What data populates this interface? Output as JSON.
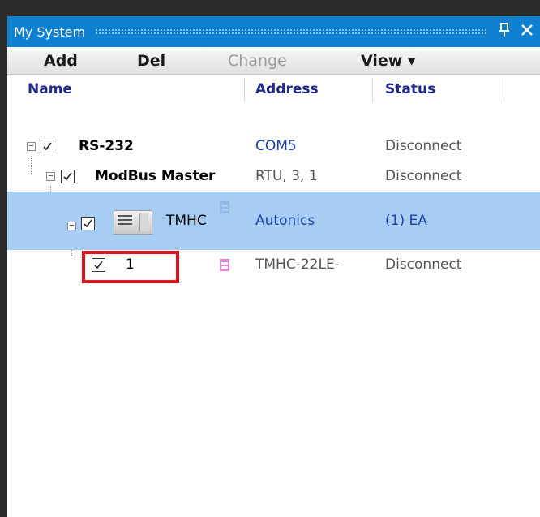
{
  "window": {
    "title": "My System",
    "pin_icon": "pin-icon",
    "close_icon": "close-icon"
  },
  "toolbar": {
    "add_label": "Add",
    "del_label": "Del",
    "change_label": "Change",
    "view_label": "View ▾"
  },
  "columns": {
    "name": "Name",
    "address": "Address",
    "status": "Status"
  },
  "rows": [
    {
      "name": "RS-232",
      "address": "COM5",
      "status": "Disconnect",
      "checked": true
    },
    {
      "name": "ModBus Master",
      "address": "RTU, 3, 1",
      "status": "Disconnect",
      "checked": true
    },
    {
      "name": "TMHC",
      "address": "Autonics",
      "status": "(1) EA",
      "checked": true,
      "selected": true
    },
    {
      "name": "1",
      "address": "TMHC-22LE-",
      "status": "Disconnect",
      "checked": true
    }
  ],
  "colors": {
    "title_bar": "#0f7fd0",
    "selection": "#a8cdf3",
    "highlight": "#e3121c",
    "header_text": "#1f2a8f"
  }
}
